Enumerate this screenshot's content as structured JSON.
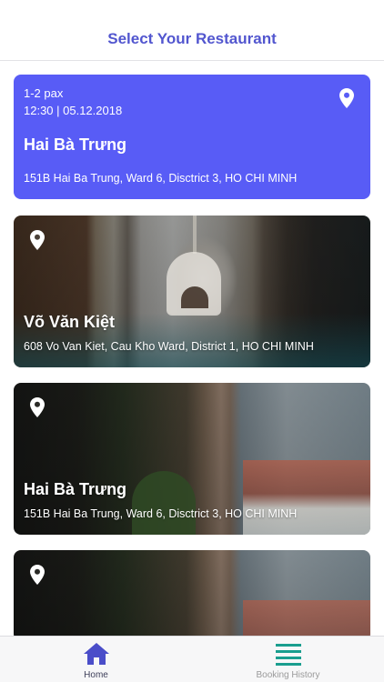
{
  "header": {
    "title": "Select Your Restaurant"
  },
  "selected": {
    "pax": "1-2 pax",
    "datetime": "12:30 | 05.12.2018",
    "name": "Hai Bà Trưng",
    "address": "151B Hai Ba Trung, Ward 6, Disctrict 3, HO CHI MINH"
  },
  "restaurants": [
    {
      "name": "Võ Văn Kiệt",
      "address": "608 Vo Van Kiet, Cau Kho Ward, District 1, HO CHI MINH"
    },
    {
      "name": "Hai Bà Trưng",
      "address": "151B Hai Ba Trung, Ward 6, Disctrict 3, HO CHI MINH"
    }
  ],
  "tabs": [
    {
      "label": "Home",
      "icon": "home-icon"
    },
    {
      "label": "Booking History",
      "icon": "list-icon"
    }
  ],
  "colors": {
    "accent": "#585cf6",
    "title": "#5256cf",
    "history_icon": "#1a9e8f",
    "battery": "#4cd964"
  }
}
